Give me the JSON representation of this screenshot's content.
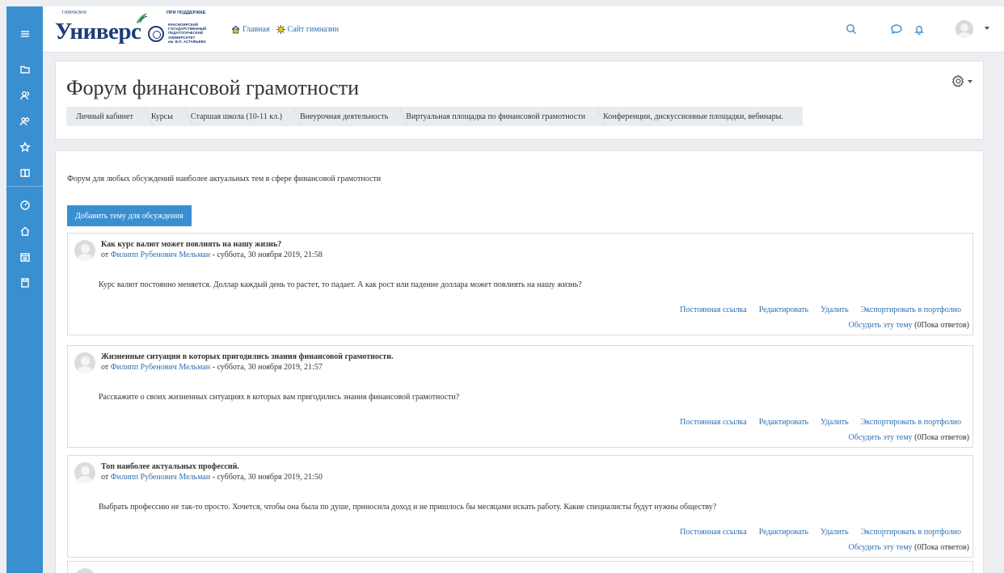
{
  "logo": {
    "gymnasium_label": "ГИМНАЗИЯ",
    "support_label": "ПРИ ПОДДЕРЖКЕ",
    "brand": "Универс",
    "university_lines": [
      "КРАСНОЯРСКИЙ",
      "ГОСУДАРСТВЕННЫЙ",
      "ПЕДАГОГИЧЕСКИЙ",
      "УНИВЕРСИТЕТ",
      "им. В.П. АСТАФЬЕВА"
    ]
  },
  "top_links": {
    "home": "Главная",
    "site": "Сайт гимназии"
  },
  "sidebar_icons": [
    "menu-icon",
    "folder-icon",
    "users-icon",
    "group-icon",
    "star-icon",
    "book-icon",
    "dashboard-icon",
    "home-icon",
    "calendar-icon",
    "files-icon"
  ],
  "page": {
    "title": "Форум финансовой грамотности"
  },
  "breadcrumb": [
    "Личный кабинет",
    "Курсы",
    "Старшая школа (10-11 кл.)",
    "Внеурочная деятельность",
    "Виртуальная площадка по финансовой грамотности",
    "Конференции, дискуссионные площадки, вебинары."
  ],
  "forum": {
    "description": "Форум для любых обсуждений наиболее актуальных тем в сфере финансовой грамотности",
    "add_button": "Добавить тему для обсуждения"
  },
  "post_labels": {
    "by": "от",
    "permalink": "Постоянная ссылка",
    "edit": "Редактировать",
    "delete": "Удалить",
    "export": "Экспортировать в портфолио",
    "discuss": "Обсудить эту тему",
    "replies": "(0Пока ответов)"
  },
  "posts": [
    {
      "subject": "Как курс валют может повлиять на нашу жизнь?",
      "author": "Филипп Рубенович Мельман",
      "date": " - суббота, 30 ноября 2019, 21:58",
      "message": "Курс валют постоянно меняется. Доллар каждый день то растет, то падает. А как рост или падение доллара может повлиять на нашу жизнь?"
    },
    {
      "subject": "Жизненные ситуации в которых пригодились знания финансовой грамотности.",
      "author": "Филипп Рубенович Мельман",
      "date": " - суббота, 30 ноября 2019, 21:57",
      "message": "Расскажите о своих жизненных ситуациях в которых вам пригодились знания финансовой грамотности?"
    },
    {
      "subject": "Топ наиболее актуальных профессий.",
      "author": "Филипп Рубенович Мельман",
      "date": " - суббота, 30 ноября 2019, 21:50",
      "message": "Выбрать профессию не так-то просто. Хочется, чтобы она была по душе, приносила доход и не пришлось бы месяцами искать работу. Какие специалисты будут нужны обществу?"
    }
  ],
  "colors": {
    "sidebar": "#3a8fd1",
    "link": "#2a6fb3",
    "button": "#3a8fd1",
    "background": "#eceef1"
  }
}
